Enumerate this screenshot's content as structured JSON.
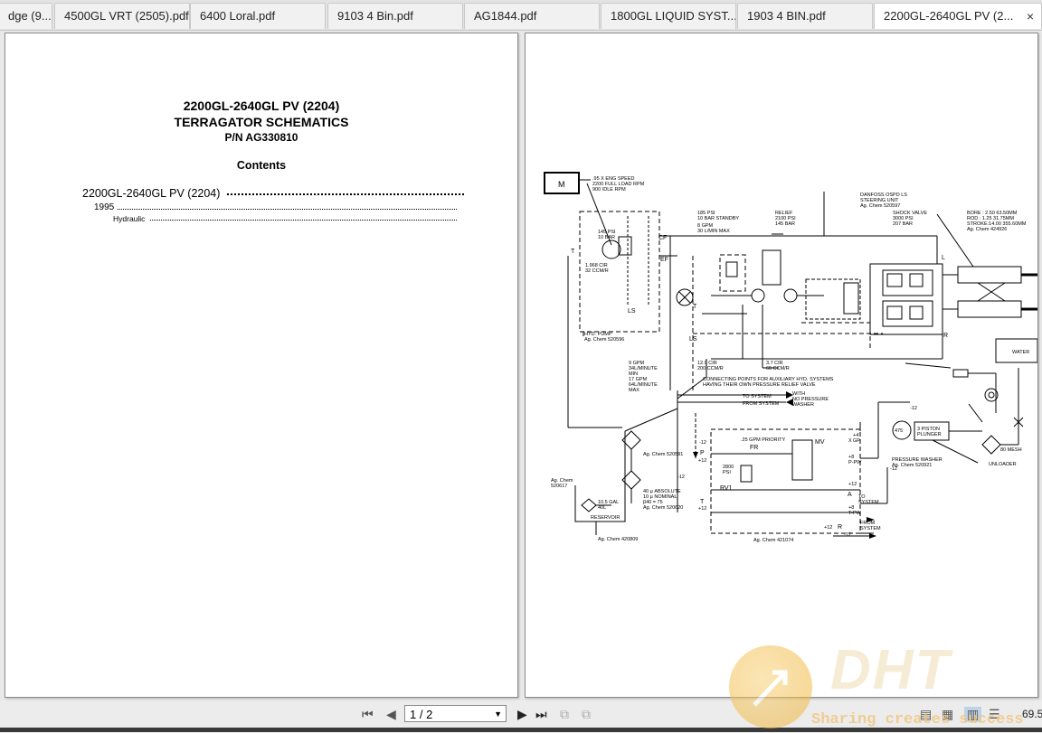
{
  "tabs": [
    {
      "label": "dge (9..."
    },
    {
      "label": "4500GL VRT (2505).pdf"
    },
    {
      "label": "6400 Loral.pdf"
    },
    {
      "label": "9103 4 Bin.pdf"
    },
    {
      "label": "AG1844.pdf"
    },
    {
      "label": "1800GL LIQUID SYST..."
    },
    {
      "label": "1903 4 BIN.pdf"
    },
    {
      "label": "2200GL-2640GL PV (2...",
      "active": true
    }
  ],
  "tab_close_glyph": "×",
  "page1": {
    "title_line1": "2200GL-2640GL PV (2204)",
    "title_line2": "TERRAGATOR SCHEMATICS",
    "title_line3": "P/N AG330810",
    "contents_heading": "Contents",
    "toc": [
      {
        "label": "2200GL-2640GL PV (2204)"
      },
      {
        "label": "1995"
      },
      {
        "label": "Hydraulic"
      }
    ]
  },
  "schematic": {
    "motor_label": "M",
    "eng_speed": [
      ".95 X ENG SPEED",
      "2200 FULL LOAD RPM",
      "900 IDLE RPM"
    ],
    "standby": [
      "185 PSI",
      "10 BAR STANDBY",
      "8 GPM",
      "30 L/MIN MAX"
    ],
    "relief": [
      "RELIEF",
      "2100 PSI",
      "145 BAR"
    ],
    "danfoss": [
      "DANFOSS OSPD LS",
      "STEERING UNIT",
      "Ag. Chem 520597"
    ],
    "shock_valve": [
      "SHOCK VALVE",
      "3000 PSI",
      "207 BAR"
    ],
    "cylinder": [
      "BORE : 2.50  63.50MM",
      "ROD : 1.25  31.75MM",
      "STROKE:14.00 355.60MM",
      "Ag. Chem 424926"
    ],
    "pump_145": [
      "145 PSI",
      "10 BAR"
    ],
    "pump_cir": [
      "1.968 CIR",
      "32 CCM/R"
    ],
    "cf": "CF",
    "ef": "EF",
    "ls_left": "LS",
    "ls_mid": "LS",
    "t_left": "T",
    "t_mid": "T",
    "l_right": "L",
    "r_right": "R",
    "hyd_pump": [
      "HYD. PUMP",
      "Ag. Chem 520596"
    ],
    "cir_12": [
      "12.9 CIR",
      "200 CCM/R"
    ],
    "cir_3": [
      "3.7 CIR",
      "60 CCM/R"
    ],
    "gpm_block": [
      "9 GPM",
      "34L/MINUTE",
      "MIN",
      "17 GPM",
      "64L/MINUTE",
      "MAX"
    ],
    "connecting": [
      "CONNECTING POINTS FOR AUXILIARY HYD. SYSTEMS",
      "HAVING THEIR OWN PRESSURE RELIEF VALVE"
    ],
    "to_system": "TO SYSTEM",
    "from_system": "FROM SYSTEM",
    "with_pressure": [
      "WITH",
      "NO PRESSURE",
      "WASHER"
    ],
    "filter1": "Ag. Chem 520591",
    "filter2": [
      "40 μ ABSOLUTE",
      "10 μ NOMINAL",
      "β40 = 75",
      "Ag. Chem 520620"
    ],
    "ag_chem_left": [
      "Ag. Chem",
      "520617"
    ],
    "reservoir": [
      "10.5 GAL",
      "40L",
      "RESERVOIR"
    ],
    "res_part": "Ag. Chem 420809",
    "priority": ".25 GPM PRIORITY",
    "fr": "FR",
    "mv": "MV",
    "rv1": "RV1",
    "rv_psi": [
      "2800",
      "PSI"
    ],
    "block_part": "Ag. Chem 421074",
    "p_pw": "P-PW",
    "t_pw": "T-PW",
    "x_gp": [
      "X",
      "GP"
    ],
    "to_system2": [
      "TO",
      "SYSTEM"
    ],
    "from_system2": [
      "FROM",
      "SYSTEM"
    ],
    "water": "WATER",
    "piston": [
      "3 PISTON",
      "PLUNGER"
    ],
    "pressure_washer": [
      "PRESSURE WASHER",
      "Ag. Chem 520921"
    ],
    "unloader": "UNLOADER",
    "mesh": "80 MESH",
    "m12": "-12",
    "p12": "+12",
    "p8": "+8",
    "p4": "+4",
    "p_letter": "P",
    "t_letter": "T",
    "a_letter": "A",
    "r_letter": "R",
    "gp_475": "475"
  },
  "statusbar": {
    "page_value": "1 / 2",
    "zoom": "69.5"
  },
  "watermark": {
    "brand": "DHT",
    "slogan": "Sharing creates success"
  }
}
